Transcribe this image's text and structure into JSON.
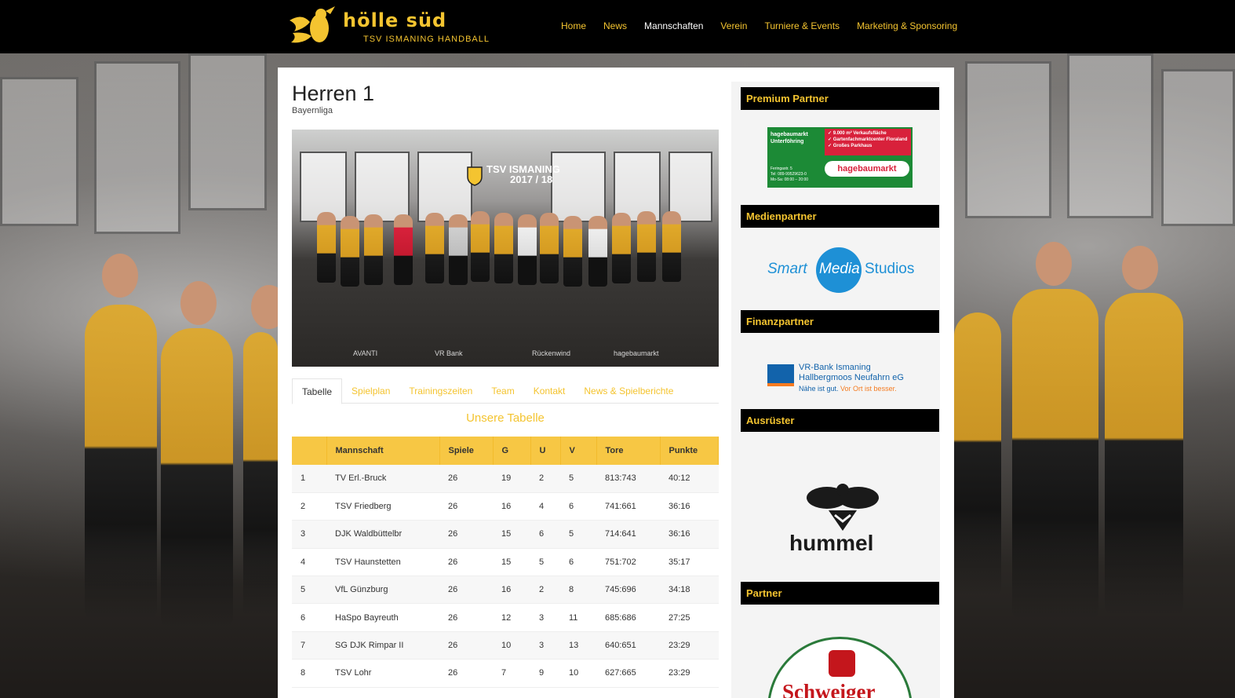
{
  "header": {
    "logo_title": "hölle süd",
    "logo_subtitle": "TSV ISMANING HANDBALL",
    "nav": [
      {
        "label": "Home",
        "active": false
      },
      {
        "label": "News",
        "active": false
      },
      {
        "label": "Mannschaften",
        "active": true
      },
      {
        "label": "Verein",
        "active": false
      },
      {
        "label": "Turniere & Events",
        "active": false
      },
      {
        "label": "Marketing & Sponsoring",
        "active": false
      }
    ]
  },
  "page": {
    "title": "Herren 1",
    "subtitle": "Bayernliga",
    "photo": {
      "caption_line1": "TSV ISMANING",
      "caption_line2": "2017 / 18",
      "sponsors": [
        "AVANTI",
        "VR Bank",
        "Rückenwind",
        "hagebaumarkt"
      ]
    },
    "tabs": [
      "Tabelle",
      "Spielplan",
      "Trainingszeiten",
      "Team",
      "Kontakt",
      "News & Spielberichte"
    ],
    "active_tab": "Tabelle"
  },
  "standings": {
    "heading": "Unsere Tabelle",
    "columns": [
      "",
      "Mannschaft",
      "Spiele",
      "G",
      "U",
      "V",
      "Tore",
      "Punkte"
    ],
    "rows": [
      [
        "1",
        "TV Erl.-Bruck",
        "26",
        "19",
        "2",
        "5",
        "813:743",
        "40:12"
      ],
      [
        "2",
        "TSV Friedberg",
        "26",
        "16",
        "4",
        "6",
        "741:661",
        "36:16"
      ],
      [
        "3",
        "DJK Waldbüttelbr",
        "26",
        "15",
        "6",
        "5",
        "714:641",
        "36:16"
      ],
      [
        "4",
        "TSV Haunstetten",
        "26",
        "15",
        "5",
        "6",
        "751:702",
        "35:17"
      ],
      [
        "5",
        "VfL Günzburg",
        "26",
        "16",
        "2",
        "8",
        "745:696",
        "34:18"
      ],
      [
        "6",
        "HaSpo Bayreuth",
        "26",
        "12",
        "3",
        "11",
        "685:686",
        "27:25"
      ],
      [
        "7",
        "SG DJK Rimpar II",
        "26",
        "10",
        "3",
        "13",
        "640:651",
        "23:29"
      ],
      [
        "8",
        "TSV Lohr",
        "26",
        "7",
        "9",
        "10",
        "627:665",
        "23:29"
      ]
    ]
  },
  "sidebar": {
    "premium": {
      "heading": "Premium Partner",
      "logo": {
        "left": "hagebaumarkt\nUnterföhring",
        "bullets": "✓ 9.000 m² Verkaufsfläche\n✓ Gartenfachmarktcenter Floraland\n✓ Großes Parkhaus",
        "brand": "hagebaumarkt",
        "info": "Feringastr. 5\nTel: 089-99529623-0\nMo-Sa: 08:00 – 20:00"
      }
    },
    "media": {
      "heading": "Medienpartner",
      "logo_words": [
        "Smart",
        "Media",
        "Studios"
      ]
    },
    "finance": {
      "heading": "Finanzpartner",
      "logo_text": "VR-Bank Ismaning\nHallbergmoos Neufahrn eG",
      "slogan_a": "Nähe ist gut.",
      "slogan_b": "Vor Ort ist besser."
    },
    "outfitter": {
      "heading": "Ausrüster",
      "logo_word": "hummel"
    },
    "partner": {
      "heading": "Partner",
      "logo_word": "Schweiger"
    }
  },
  "colors": {
    "accent": "#f4c430",
    "table_header": "#f7c744",
    "topbar": "#000000"
  }
}
